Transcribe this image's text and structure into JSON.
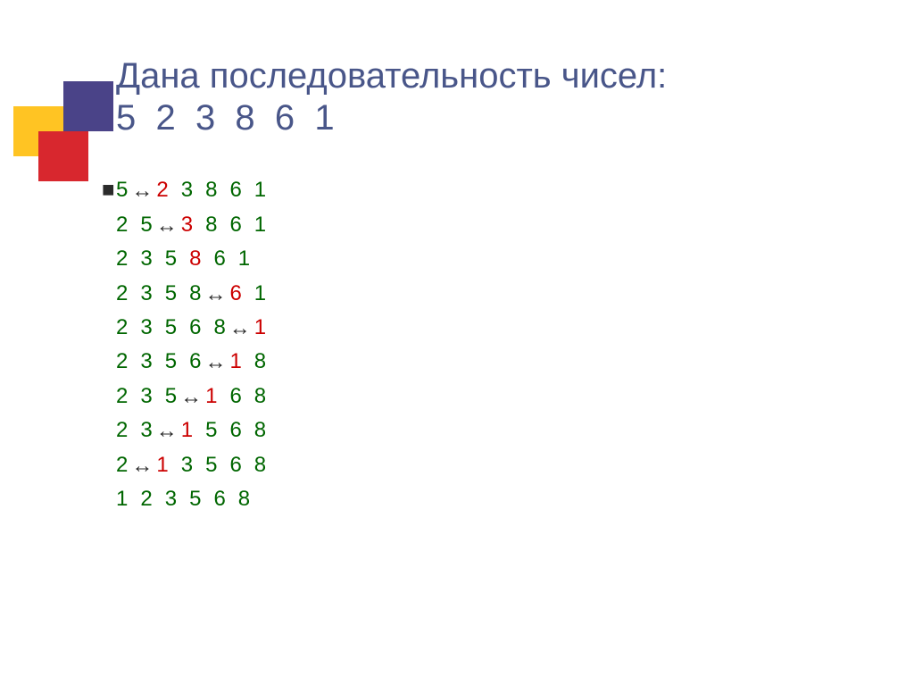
{
  "title_line1": "Дана последовательность чисел:",
  "title_line2": "5  2  3  8  6  1",
  "bullet": "■",
  "arrow_glyph": "↔",
  "rows": [
    {
      "cells": [
        {
          "v": "5",
          "c": "num"
        },
        {
          "v": "↔",
          "c": "arrow",
          "tight": true
        },
        {
          "v": "2",
          "c": "red",
          "tight": true
        },
        {
          "v": "3",
          "c": "num"
        },
        {
          "v": "8",
          "c": "num"
        },
        {
          "v": "6",
          "c": "num"
        },
        {
          "v": "1",
          "c": "num"
        }
      ]
    },
    {
      "cells": [
        {
          "v": "2",
          "c": "num"
        },
        {
          "v": "5",
          "c": "num"
        },
        {
          "v": "↔",
          "c": "arrow",
          "tight": true
        },
        {
          "v": "3",
          "c": "red",
          "tight": true
        },
        {
          "v": "8",
          "c": "num"
        },
        {
          "v": "6",
          "c": "num"
        },
        {
          "v": "1",
          "c": "num"
        }
      ]
    },
    {
      "cells": [
        {
          "v": "2",
          "c": "num"
        },
        {
          "v": "3",
          "c": "num"
        },
        {
          "v": "5",
          "c": "num"
        },
        {
          "v": "8",
          "c": "red"
        },
        {
          "v": "6",
          "c": "num"
        },
        {
          "v": "1",
          "c": "num"
        }
      ]
    },
    {
      "cells": [
        {
          "v": "2",
          "c": "num"
        },
        {
          "v": "3",
          "c": "num"
        },
        {
          "v": "5",
          "c": "num"
        },
        {
          "v": "8",
          "c": "num"
        },
        {
          "v": "↔",
          "c": "arrow",
          "tight": true
        },
        {
          "v": "6",
          "c": "red",
          "tight": true
        },
        {
          "v": "1",
          "c": "num"
        }
      ]
    },
    {
      "cells": [
        {
          "v": "2",
          "c": "num"
        },
        {
          "v": "3",
          "c": "num"
        },
        {
          "v": "5",
          "c": "num"
        },
        {
          "v": "6",
          "c": "num"
        },
        {
          "v": "8",
          "c": "num"
        },
        {
          "v": "↔",
          "c": "arrow",
          "tight": true
        },
        {
          "v": "1",
          "c": "red",
          "tight": true
        }
      ]
    },
    {
      "cells": [
        {
          "v": "2",
          "c": "num"
        },
        {
          "v": "3",
          "c": "num"
        },
        {
          "v": "5",
          "c": "num"
        },
        {
          "v": "6",
          "c": "num"
        },
        {
          "v": "↔",
          "c": "arrow",
          "tight": true
        },
        {
          "v": "1",
          "c": "red",
          "tight": true
        },
        {
          "v": "8",
          "c": "num"
        }
      ]
    },
    {
      "cells": [
        {
          "v": "2",
          "c": "num"
        },
        {
          "v": "3",
          "c": "num"
        },
        {
          "v": "5",
          "c": "num"
        },
        {
          "v": "↔",
          "c": "arrow",
          "tight": true
        },
        {
          "v": "1",
          "c": "red",
          "tight": true
        },
        {
          "v": "6",
          "c": "num"
        },
        {
          "v": "8",
          "c": "num"
        }
      ]
    },
    {
      "cells": [
        {
          "v": "2",
          "c": "num"
        },
        {
          "v": "3",
          "c": "num"
        },
        {
          "v": "↔",
          "c": "arrow",
          "tight": true
        },
        {
          "v": "1",
          "c": "red",
          "tight": true
        },
        {
          "v": "5",
          "c": "num"
        },
        {
          "v": "6",
          "c": "num"
        },
        {
          "v": "8",
          "c": "num"
        }
      ]
    },
    {
      "cells": [
        {
          "v": "2",
          "c": "num"
        },
        {
          "v": "↔",
          "c": "arrow",
          "tight": true
        },
        {
          "v": "1",
          "c": "red",
          "tight": true
        },
        {
          "v": "3",
          "c": "num"
        },
        {
          "v": "5",
          "c": "num"
        },
        {
          "v": "6",
          "c": "num"
        },
        {
          "v": "8",
          "c": "num"
        }
      ]
    },
    {
      "cells": [
        {
          "v": "1",
          "c": "num"
        },
        {
          "v": "2",
          "c": "num"
        },
        {
          "v": "3",
          "c": "num"
        },
        {
          "v": "5",
          "c": "num"
        },
        {
          "v": "6",
          "c": "num"
        },
        {
          "v": "8",
          "c": "num"
        }
      ]
    }
  ]
}
